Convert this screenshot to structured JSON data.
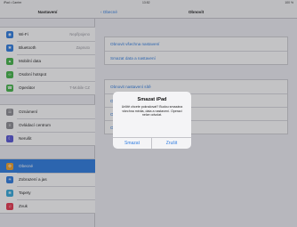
{
  "status_bar": {
    "carrier": "iPad • Carrier",
    "time": "13:52",
    "battery": "100 %"
  },
  "left_nav": {
    "title": "Nastavení"
  },
  "left_groups": [
    [
      {
        "label": "Wi-Fi",
        "value": "Nepřipojeno",
        "icon": "wifi-icon",
        "icon_glyph": "◉",
        "color": "#2f7de1"
      },
      {
        "label": "Bluetooth",
        "value": "Zapnuto",
        "icon": "bluetooth-icon",
        "icon_glyph": "✱",
        "color": "#2f7de1"
      },
      {
        "label": "Mobilní data",
        "value": "",
        "icon": "antenna-icon",
        "icon_glyph": "▲",
        "color": "#44b649"
      },
      {
        "label": "Osobní hotspot",
        "value": "",
        "icon": "hotspot-icon",
        "icon_glyph": "∞",
        "color": "#44b649"
      },
      {
        "label": "Operátor",
        "value": "T-Mobile CZ",
        "icon": "phone-icon",
        "icon_glyph": "☎",
        "color": "#44b649"
      }
    ],
    [
      {
        "label": "Oznámení",
        "value": "",
        "icon": "notifications-icon",
        "icon_glyph": "☰",
        "color": "#8e8e93"
      },
      {
        "label": "Ovládací centrum",
        "value": "",
        "icon": "control-center-icon",
        "icon_glyph": "≡",
        "color": "#8e8e93"
      },
      {
        "label": "Nerušit",
        "value": "",
        "icon": "moon-icon",
        "icon_glyph": "☾",
        "color": "#5856d6"
      }
    ],
    [
      {
        "label": "Obecné",
        "value": "",
        "icon": "gear-icon",
        "icon_glyph": "⚙",
        "color": "#f2a22b",
        "selected": true
      },
      {
        "label": "Zobrazení a jas",
        "value": "",
        "icon": "brightness-icon",
        "icon_glyph": "☀",
        "color": "#2f7de1"
      },
      {
        "label": "Tapety",
        "value": "",
        "icon": "wallpaper-icon",
        "icon_glyph": "❀",
        "color": "#35aadc"
      },
      {
        "label": "Zvuk",
        "value": "",
        "icon": "speaker-icon",
        "icon_glyph": "♫",
        "color": "#e8384f"
      }
    ]
  ],
  "right_nav": {
    "back": "‹ Obecné",
    "title": "Obnovit"
  },
  "right_groups": [
    [
      "Obnovit všechna nastavení",
      "Smazat data a nastavení"
    ],
    [
      "Obnovit nastavení sítě",
      "Obnovit slovník klávesnice",
      "Obnovit plochu",
      "Obnovit polohu a soukromí"
    ]
  ],
  "alert": {
    "title": "Smazat iPad",
    "message": "Určitě chcete pokračovat? Budou smazána všechna média, data a nastavení. Operaci nelze odvolat.",
    "cancel_label": "Smazat",
    "confirm_label": "Zrušit"
  }
}
